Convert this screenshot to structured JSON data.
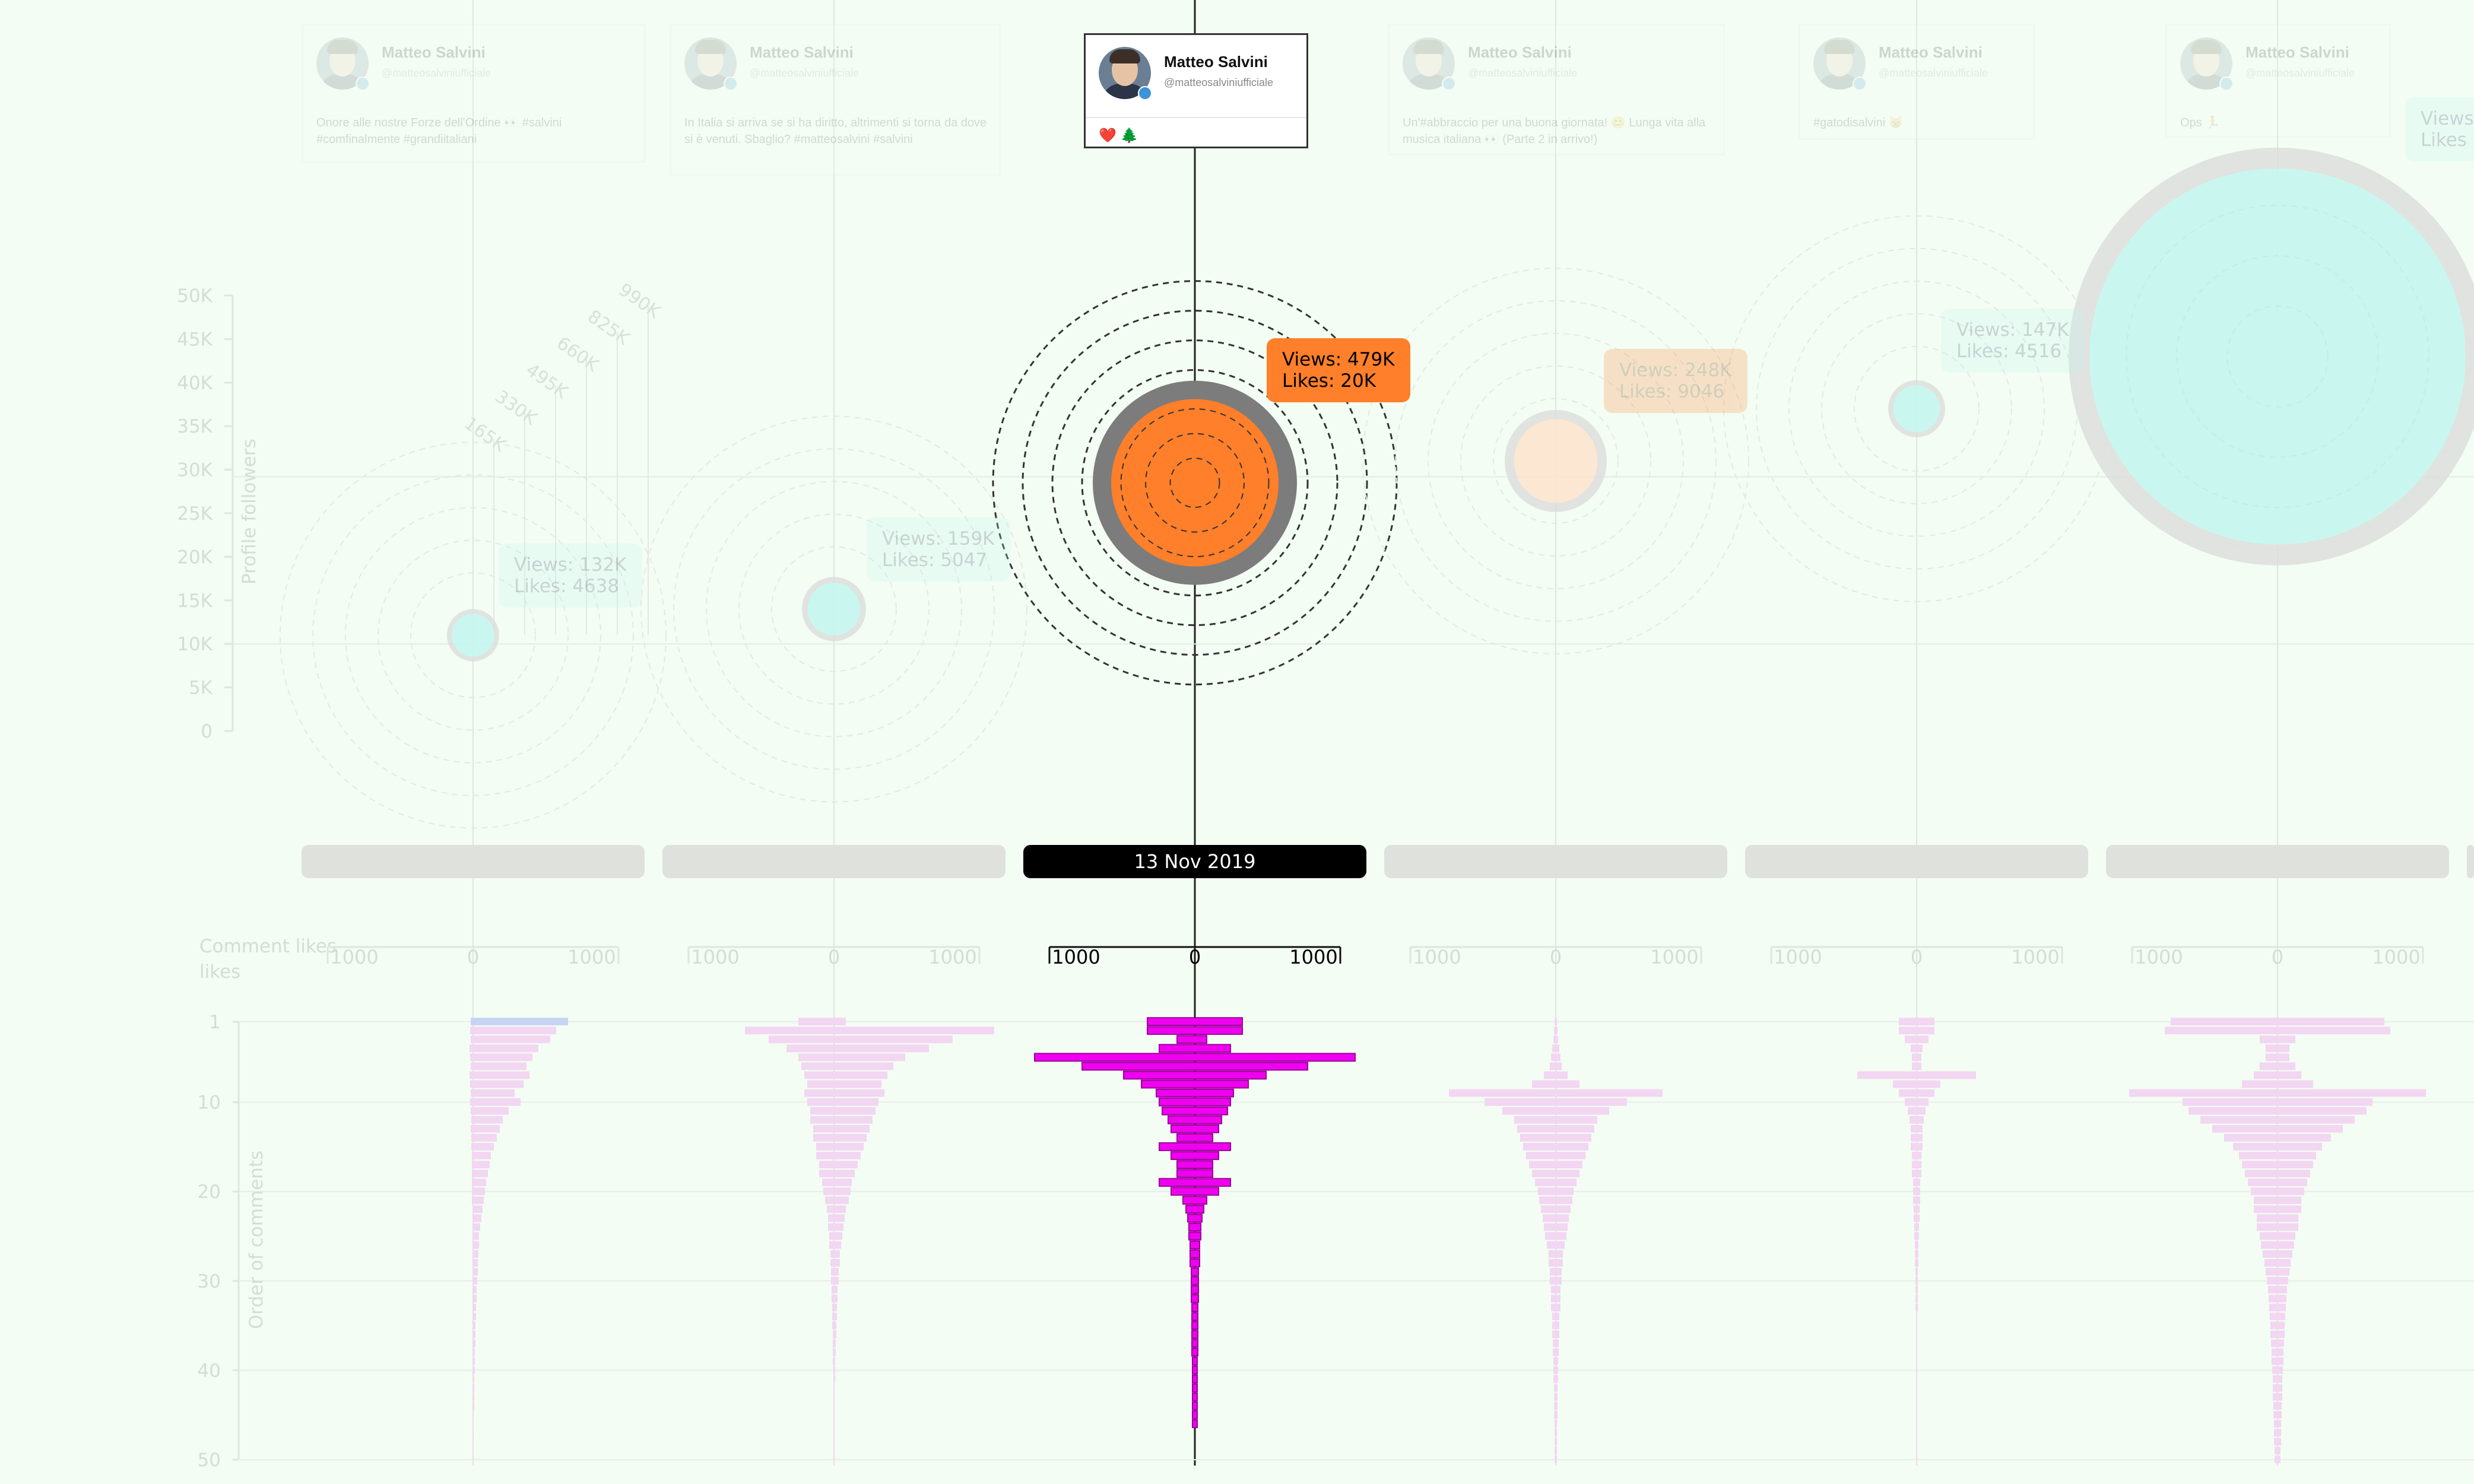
{
  "colors": {
    "background": "#f3fdf3",
    "accent_orange": "#ff7f2a",
    "accent_cyan": "#bff6f0",
    "comment_bar_active": "#f000f0",
    "comment_bar_faded": "#f2d6f2",
    "selected_date_bg": "#000000"
  },
  "icons": [
    "avatar-image",
    "verified-badge-icon",
    "heart-icon",
    "tree-icon"
  ],
  "chart_data": {
    "type": "scatter",
    "description_free": true,
    "y_axis_followers": {
      "label": "Profile followers",
      "ticks": [
        "0",
        "5K",
        "10K",
        "15K",
        "20K",
        "25K",
        "30K",
        "35K",
        "40K",
        "45K",
        "50K"
      ]
    },
    "view_scale_ticks": [
      "165K",
      "330K",
      "495K",
      "660K",
      "825K",
      "990K"
    ],
    "comment_axis": {
      "x_label": "Comment likes",
      "x_ticks": [
        "1000",
        "0",
        "1000"
      ],
      "y_label": "Order of comments",
      "y_ticks": [
        "1",
        "10",
        "20",
        "30",
        "40",
        "50"
      ]
    },
    "selected_index": 2,
    "posts": [
      {
        "author": "Matteo Salvini",
        "handle": "@matteosalviniufficiale",
        "text": "Onore alle nostre Forze dell'Ordine 👀 #salvini #comfinalmente #grandiitaliani",
        "views": 132000,
        "likes": 4638,
        "views_label": "Views: 132K",
        "likes_label": "Likes: 4638",
        "followers": 11000,
        "color": "cyan",
        "date": "",
        "comments": [
          [
            4,
            160
          ],
          [
            5,
            140
          ],
          [
            4,
            130
          ],
          [
            6,
            110
          ],
          [
            5,
            100
          ],
          [
            4,
            90
          ],
          [
            6,
            95
          ],
          [
            5,
            85
          ],
          [
            4,
            70
          ],
          [
            5,
            80
          ],
          [
            4,
            60
          ],
          [
            3,
            50
          ],
          [
            4,
            45
          ],
          [
            3,
            40
          ],
          [
            3,
            35
          ],
          [
            2,
            30
          ],
          [
            2,
            28
          ],
          [
            2,
            25
          ],
          [
            2,
            22
          ],
          [
            2,
            20
          ],
          [
            2,
            18
          ],
          [
            1,
            16
          ],
          [
            1,
            14
          ],
          [
            1,
            12
          ],
          [
            1,
            10
          ],
          [
            1,
            10
          ],
          [
            1,
            9
          ],
          [
            1,
            8
          ],
          [
            1,
            8
          ],
          [
            1,
            7
          ],
          [
            1,
            6
          ],
          [
            1,
            6
          ],
          [
            1,
            5
          ],
          [
            1,
            5
          ],
          [
            1,
            4
          ],
          [
            1,
            4
          ],
          [
            1,
            4
          ],
          [
            1,
            3
          ],
          [
            1,
            3
          ],
          [
            1,
            3
          ],
          [
            1,
            2
          ],
          [
            1,
            2
          ],
          [
            1,
            2
          ],
          [
            1,
            2
          ],
          [
            1,
            1
          ],
          [
            1,
            1
          ],
          [
            1,
            1
          ],
          [
            1,
            1
          ],
          [
            1,
            1
          ],
          [
            1,
            1
          ]
        ]
      },
      {
        "author": "Matteo Salvini",
        "handle": "@matteosalviniufficiale",
        "text": "In Italia si arriva se si ha diritto, altrimenti si torna da dove si è venuti. Sbaglio? #matteosalvini #salvini",
        "views": 159000,
        "likes": 5047,
        "views_label": "Views: 159K",
        "likes_label": "Likes: 5047",
        "followers": 14000,
        "color": "cyan",
        "date": "",
        "comments": [
          [
            60,
            20
          ],
          [
            150,
            270
          ],
          [
            110,
            200
          ],
          [
            80,
            160
          ],
          [
            60,
            120
          ],
          [
            55,
            100
          ],
          [
            50,
            90
          ],
          [
            45,
            80
          ],
          [
            50,
            85
          ],
          [
            45,
            75
          ],
          [
            40,
            70
          ],
          [
            40,
            65
          ],
          [
            35,
            60
          ],
          [
            35,
            55
          ],
          [
            30,
            50
          ],
          [
            30,
            45
          ],
          [
            25,
            40
          ],
          [
            25,
            35
          ],
          [
            20,
            30
          ],
          [
            18,
            28
          ],
          [
            15,
            25
          ],
          [
            12,
            20
          ],
          [
            10,
            18
          ],
          [
            10,
            16
          ],
          [
            8,
            14
          ],
          [
            8,
            12
          ],
          [
            6,
            10
          ],
          [
            6,
            10
          ],
          [
            5,
            8
          ],
          [
            5,
            8
          ],
          [
            4,
            6
          ],
          [
            4,
            6
          ],
          [
            3,
            5
          ],
          [
            3,
            5
          ],
          [
            3,
            4
          ],
          [
            2,
            4
          ],
          [
            2,
            3
          ],
          [
            2,
            3
          ],
          [
            2,
            2
          ],
          [
            1,
            2
          ],
          [
            1,
            2
          ],
          [
            1,
            1
          ],
          [
            1,
            1
          ],
          [
            1,
            1
          ],
          [
            1,
            1
          ],
          [
            1,
            1
          ],
          [
            1,
            1
          ],
          [
            1,
            1
          ],
          [
            1,
            1
          ],
          [
            1,
            1
          ]
        ]
      },
      {
        "author": "Matteo Salvini",
        "handle": "@matteosalviniufficiale",
        "text": "❤️ 🌲",
        "views": 479000,
        "likes": 20000,
        "views_label": "Views: 479K",
        "likes_label": "Likes: 20K",
        "followers": 28500,
        "color": "orange",
        "date": "13 Nov 2019",
        "comments": [
          [
            80,
            80
          ],
          [
            80,
            80
          ],
          [
            30,
            20
          ],
          [
            60,
            60
          ],
          [
            270,
            270
          ],
          [
            190,
            190
          ],
          [
            120,
            120
          ],
          [
            90,
            90
          ],
          [
            65,
            65
          ],
          [
            60,
            60
          ],
          [
            55,
            55
          ],
          [
            45,
            45
          ],
          [
            40,
            40
          ],
          [
            30,
            30
          ],
          [
            60,
            60
          ],
          [
            40,
            40
          ],
          [
            30,
            30
          ],
          [
            30,
            30
          ],
          [
            60,
            60
          ],
          [
            40,
            40
          ],
          [
            20,
            20
          ],
          [
            15,
            15
          ],
          [
            12,
            12
          ],
          [
            10,
            10
          ],
          [
            10,
            10
          ],
          [
            8,
            8
          ],
          [
            8,
            8
          ],
          [
            8,
            8
          ],
          [
            6,
            6
          ],
          [
            6,
            6
          ],
          [
            6,
            6
          ],
          [
            6,
            6
          ],
          [
            5,
            5
          ],
          [
            5,
            5
          ],
          [
            5,
            5
          ],
          [
            5,
            5
          ],
          [
            5,
            5
          ],
          [
            5,
            5
          ],
          [
            4,
            4
          ],
          [
            4,
            4
          ],
          [
            4,
            4
          ],
          [
            4,
            4
          ],
          [
            4,
            4
          ],
          [
            4,
            4
          ],
          [
            4,
            4
          ],
          [
            4,
            4
          ]
        ]
      },
      {
        "author": "Matteo Salvini",
        "handle": "@matteosalviniufficiale",
        "text": "Un'#abbraccio per una buona giornata! 😊 Lunga vita alla musica italiana 👀 (Parte 2 in arrivo!)",
        "views": 248000,
        "likes": 9046,
        "views_label": "Views: 248K",
        "likes_label": "Likes: 9046",
        "followers": 31000,
        "color": "orange",
        "date": "",
        "comments": [
          [
            2,
            2
          ],
          [
            3,
            3
          ],
          [
            4,
            4
          ],
          [
            6,
            6
          ],
          [
            8,
            8
          ],
          [
            10,
            10
          ],
          [
            20,
            20
          ],
          [
            40,
            40
          ],
          [
            180,
            180
          ],
          [
            120,
            120
          ],
          [
            90,
            90
          ],
          [
            70,
            70
          ],
          [
            65,
            65
          ],
          [
            60,
            60
          ],
          [
            55,
            55
          ],
          [
            50,
            50
          ],
          [
            45,
            45
          ],
          [
            40,
            40
          ],
          [
            35,
            35
          ],
          [
            30,
            30
          ],
          [
            28,
            28
          ],
          [
            25,
            25
          ],
          [
            22,
            22
          ],
          [
            20,
            20
          ],
          [
            18,
            18
          ],
          [
            15,
            15
          ],
          [
            12,
            12
          ],
          [
            12,
            12
          ],
          [
            10,
            10
          ],
          [
            10,
            10
          ],
          [
            8,
            8
          ],
          [
            8,
            8
          ],
          [
            8,
            8
          ],
          [
            6,
            6
          ],
          [
            6,
            6
          ],
          [
            6,
            6
          ],
          [
            5,
            5
          ],
          [
            5,
            5
          ],
          [
            4,
            4
          ],
          [
            4,
            4
          ],
          [
            4,
            4
          ],
          [
            3,
            3
          ],
          [
            3,
            3
          ],
          [
            3,
            3
          ],
          [
            3,
            3
          ],
          [
            2,
            2
          ],
          [
            2,
            2
          ],
          [
            2,
            2
          ],
          [
            2,
            2
          ],
          [
            2,
            2
          ]
        ]
      },
      {
        "author": "Matteo Salvini",
        "handle": "@matteosalviniufficiale",
        "text": "#gatodisalvini 😸",
        "views": 147000,
        "likes": 4516,
        "views_label": "Views: 147K",
        "likes_label": "Likes: 4516",
        "followers": 37000,
        "color": "cyan",
        "date": "",
        "comments": [
          [
            30,
            30
          ],
          [
            30,
            30
          ],
          [
            20,
            20
          ],
          [
            10,
            10
          ],
          [
            8,
            8
          ],
          [
            8,
            8
          ],
          [
            100,
            100
          ],
          [
            40,
            40
          ],
          [
            30,
            30
          ],
          [
            20,
            20
          ],
          [
            15,
            15
          ],
          [
            12,
            12
          ],
          [
            10,
            10
          ],
          [
            10,
            10
          ],
          [
            10,
            10
          ],
          [
            8,
            8
          ],
          [
            8,
            8
          ],
          [
            8,
            8
          ],
          [
            6,
            6
          ],
          [
            6,
            6
          ],
          [
            6,
            6
          ],
          [
            5,
            5
          ],
          [
            5,
            5
          ],
          [
            4,
            4
          ],
          [
            4,
            4
          ],
          [
            3,
            3
          ],
          [
            3,
            3
          ],
          [
            3,
            3
          ],
          [
            2,
            2
          ],
          [
            2,
            2
          ],
          [
            2,
            2
          ],
          [
            2,
            2
          ],
          [
            2,
            2
          ],
          [
            1,
            1
          ],
          [
            1,
            1
          ],
          [
            1,
            1
          ],
          [
            1,
            1
          ],
          [
            1,
            1
          ],
          [
            1,
            1
          ],
          [
            1,
            1
          ],
          [
            1,
            1
          ],
          [
            1,
            1
          ],
          [
            1,
            1
          ],
          [
            1,
            1
          ],
          [
            1,
            1
          ],
          [
            1,
            1
          ],
          [
            1,
            1
          ],
          [
            1,
            1
          ],
          [
            1,
            1
          ],
          [
            1,
            1
          ]
        ]
      },
      {
        "author": "Matteo Salvini",
        "handle": "@matteosalviniufficiale",
        "text": "Ops 🏃",
        "views": 1100000,
        "likes": 0,
        "views_label": "Views",
        "likes_label": "Likes",
        "followers": 43000,
        "color": "cyan",
        "date": "",
        "comments": [
          [
            180,
            180
          ],
          [
            190,
            190
          ],
          [
            30,
            30
          ],
          [
            20,
            20
          ],
          [
            20,
            20
          ],
          [
            30,
            30
          ],
          [
            40,
            40
          ],
          [
            60,
            60
          ],
          [
            250,
            250
          ],
          [
            160,
            160
          ],
          [
            150,
            150
          ],
          [
            130,
            130
          ],
          [
            110,
            110
          ],
          [
            90,
            90
          ],
          [
            75,
            75
          ],
          [
            65,
            65
          ],
          [
            60,
            60
          ],
          [
            55,
            55
          ],
          [
            50,
            50
          ],
          [
            45,
            45
          ],
          [
            40,
            40
          ],
          [
            40,
            40
          ],
          [
            35,
            35
          ],
          [
            35,
            35
          ],
          [
            30,
            30
          ],
          [
            28,
            28
          ],
          [
            25,
            25
          ],
          [
            22,
            22
          ],
          [
            20,
            20
          ],
          [
            18,
            18
          ],
          [
            16,
            16
          ],
          [
            15,
            15
          ],
          [
            14,
            14
          ],
          [
            13,
            13
          ],
          [
            12,
            12
          ],
          [
            12,
            12
          ],
          [
            11,
            11
          ],
          [
            10,
            10
          ],
          [
            10,
            10
          ],
          [
            9,
            9
          ],
          [
            8,
            8
          ],
          [
            8,
            8
          ],
          [
            8,
            8
          ],
          [
            7,
            7
          ],
          [
            7,
            7
          ],
          [
            6,
            6
          ],
          [
            6,
            6
          ],
          [
            6,
            6
          ],
          [
            5,
            5
          ],
          [
            5,
            5
          ]
        ]
      }
    ]
  }
}
